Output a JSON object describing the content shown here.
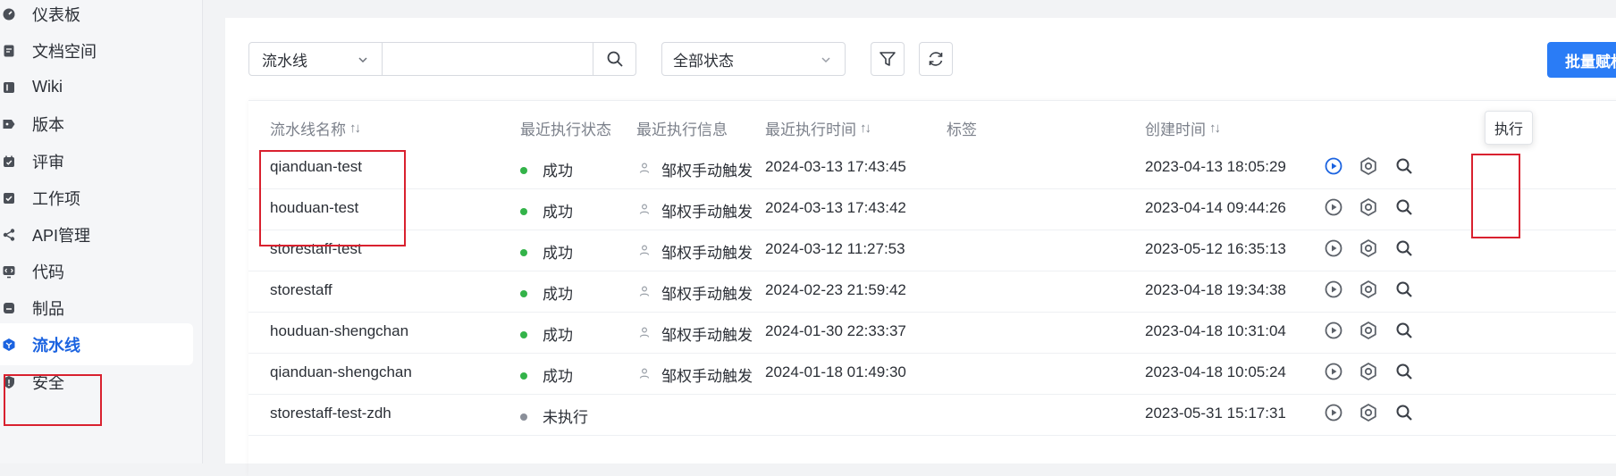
{
  "sidebar": {
    "items": [
      {
        "label": "仪表板",
        "icon": "dashboard-icon"
      },
      {
        "label": "文档空间",
        "icon": "document-icon"
      },
      {
        "label": "Wiki",
        "icon": "wiki-icon"
      },
      {
        "label": "版本",
        "icon": "tag-icon"
      },
      {
        "label": "评审",
        "icon": "review-icon"
      },
      {
        "label": "工作项",
        "icon": "checklist-icon"
      },
      {
        "label": "API管理",
        "icon": "share-icon"
      },
      {
        "label": "代码",
        "icon": "code-icon"
      },
      {
        "label": "制品",
        "icon": "package-icon"
      },
      {
        "label": "流水线",
        "icon": "pipeline-icon"
      },
      {
        "label": "安全",
        "icon": "shield-icon"
      }
    ],
    "active": "流水线"
  },
  "toolbar": {
    "pipeline_select": "流水线",
    "search_placeholder": "",
    "status_select": "全部状态",
    "batch_button": "批量赋权"
  },
  "table": {
    "headers": {
      "name": "流水线名称",
      "status": "最近执行状态",
      "info": "最近执行信息",
      "time": "最近执行时间",
      "tags": "标签",
      "created": "创建时间"
    },
    "sort_glyph": "↑↓",
    "rows": [
      {
        "name": "qianduan-test",
        "status": "成功",
        "status_color": "#33b349",
        "trigger": "邹权手动触发",
        "time": "2024-03-13 17:43:45",
        "tags": "",
        "created": "2023-04-13 18:05:29"
      },
      {
        "name": "houduan-test",
        "status": "成功",
        "status_color": "#33b349",
        "trigger": "邹权手动触发",
        "time": "2024-03-13 17:43:42",
        "tags": "",
        "created": "2023-04-14 09:44:26"
      },
      {
        "name": "storestaff-test",
        "status": "成功",
        "status_color": "#33b349",
        "trigger": "邹权手动触发",
        "time": "2024-03-12 11:27:53",
        "tags": "",
        "created": "2023-05-12 16:35:13"
      },
      {
        "name": "storestaff",
        "status": "成功",
        "status_color": "#33b349",
        "trigger": "邹权手动触发",
        "time": "2024-02-23 21:59:42",
        "tags": "",
        "created": "2023-04-18 19:34:38"
      },
      {
        "name": "houduan-shengchan",
        "status": "成功",
        "status_color": "#33b349",
        "trigger": "邹权手动触发",
        "time": "2024-01-30 22:33:37",
        "tags": "",
        "created": "2023-04-18 10:31:04"
      },
      {
        "name": "qianduan-shengchan",
        "status": "成功",
        "status_color": "#33b349",
        "trigger": "邹权手动触发",
        "time": "2024-01-18 01:49:30",
        "tags": "",
        "created": "2023-04-18 10:05:24"
      },
      {
        "name": "storestaff-test-zdh",
        "status": "未执行",
        "status_color": "#8a8f99",
        "trigger": "",
        "time": "",
        "tags": "",
        "created": "2023-05-31 15:17:31"
      }
    ]
  },
  "tooltip": "执行",
  "colors": {
    "accent": "#1b63e0",
    "primary_button": "#2a7cf6",
    "success": "#33b349",
    "idle": "#8a8f99",
    "highlight_box": "#d9212f"
  }
}
